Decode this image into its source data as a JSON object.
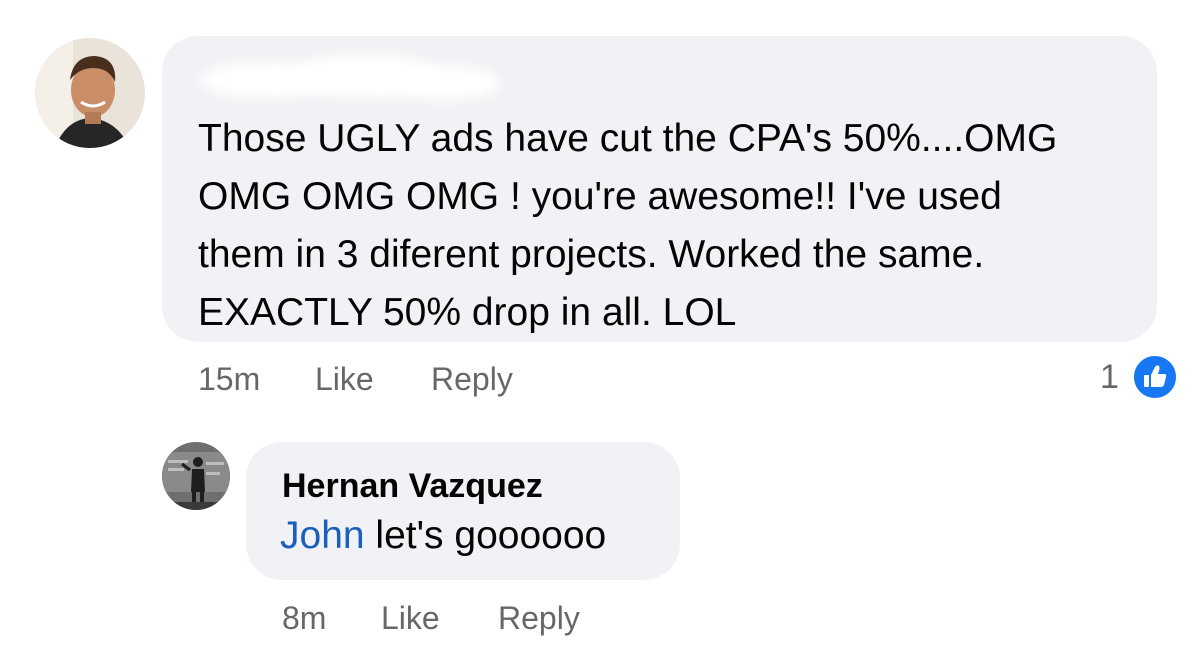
{
  "comment": {
    "author_name": "",
    "text": "Those UGLY ads have cut the CPA's 50%....OMG\nOMG OMG OMG ! you're awesome!! I've used\nthem in 3 diferent projects. Worked the same.\nEXACTLY 50% drop in all. LOL",
    "timestamp": "15m",
    "like_label": "Like",
    "reply_label": "Reply",
    "reaction_count": "1",
    "reaction_icon": "thumbs-up-icon"
  },
  "reply": {
    "author_name": "Hernan Vazquez",
    "mention": "John",
    "text": " let's goooooo",
    "timestamp": "8m",
    "like_label": "Like",
    "reply_label": "Reply"
  },
  "colors": {
    "bubble": "#f0f2f5",
    "secondary_text": "#65676b",
    "mention": "#1b5fbd",
    "like_blue": "#1877f2"
  }
}
